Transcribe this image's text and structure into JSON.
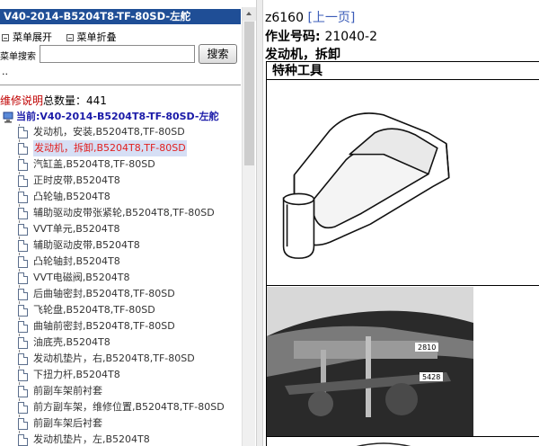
{
  "left_panel": {
    "title": "V40-2014-B5204T8-TF-80SD-左舵",
    "menu_expand": "菜单展开",
    "menu_collapse": "菜单折叠",
    "search_label": "菜单搜索",
    "search_value": "",
    "search_button": "搜索",
    "ellipsis": "..",
    "total_red": "维修说明",
    "total_rest": "总数量：441",
    "current": "当前:V40-2014-B5204T8-TF-80SD-左舵",
    "items": [
      {
        "label": "发动机，安装,B5204T8,TF-80SD",
        "active": false
      },
      {
        "label": "发动机，拆卸,B5204T8,TF-80SD",
        "active": true
      },
      {
        "label": "汽缸盖,B5204T8,TF-80SD",
        "active": false
      },
      {
        "label": "正时皮带,B5204T8",
        "active": false
      },
      {
        "label": "凸轮轴,B5204T8",
        "active": false
      },
      {
        "label": "辅助驱动皮带张紧轮,B5204T8,TF-80SD",
        "active": false
      },
      {
        "label": "VVT单元,B5204T8",
        "active": false
      },
      {
        "label": "辅助驱动皮带,B5204T8",
        "active": false
      },
      {
        "label": "凸轮轴封,B5204T8",
        "active": false
      },
      {
        "label": "VVT电磁阀,B5204T8",
        "active": false
      },
      {
        "label": "后曲轴密封,B5204T8,TF-80SD",
        "active": false
      },
      {
        "label": "飞轮盘,B5204T8,TF-80SD",
        "active": false
      },
      {
        "label": "曲轴前密封,B5204T8,TF-80SD",
        "active": false
      },
      {
        "label": "油底壳,B5204T8",
        "active": false
      },
      {
        "label": "发动机垫片，右,B5204T8,TF-80SD",
        "active": false
      },
      {
        "label": "下扭力杆,B5204T8",
        "active": false
      },
      {
        "label": "前副车架前衬套",
        "active": false
      },
      {
        "label": "前方副车架，维修位置,B5204T8,TF-80SD",
        "active": false
      },
      {
        "label": "前副车架后衬套",
        "active": false
      },
      {
        "label": "发动机垫片，左,B5204T8",
        "active": false
      }
    ]
  },
  "right_panel": {
    "doc_id": "z6160",
    "prev_link": "[上一页]",
    "job_label": "作业号码:",
    "job_number": "21040-2",
    "heading": "发动机，拆卸",
    "tools_heading": "特种工具",
    "tool_numbers": [
      "2810",
      "5428"
    ]
  }
}
